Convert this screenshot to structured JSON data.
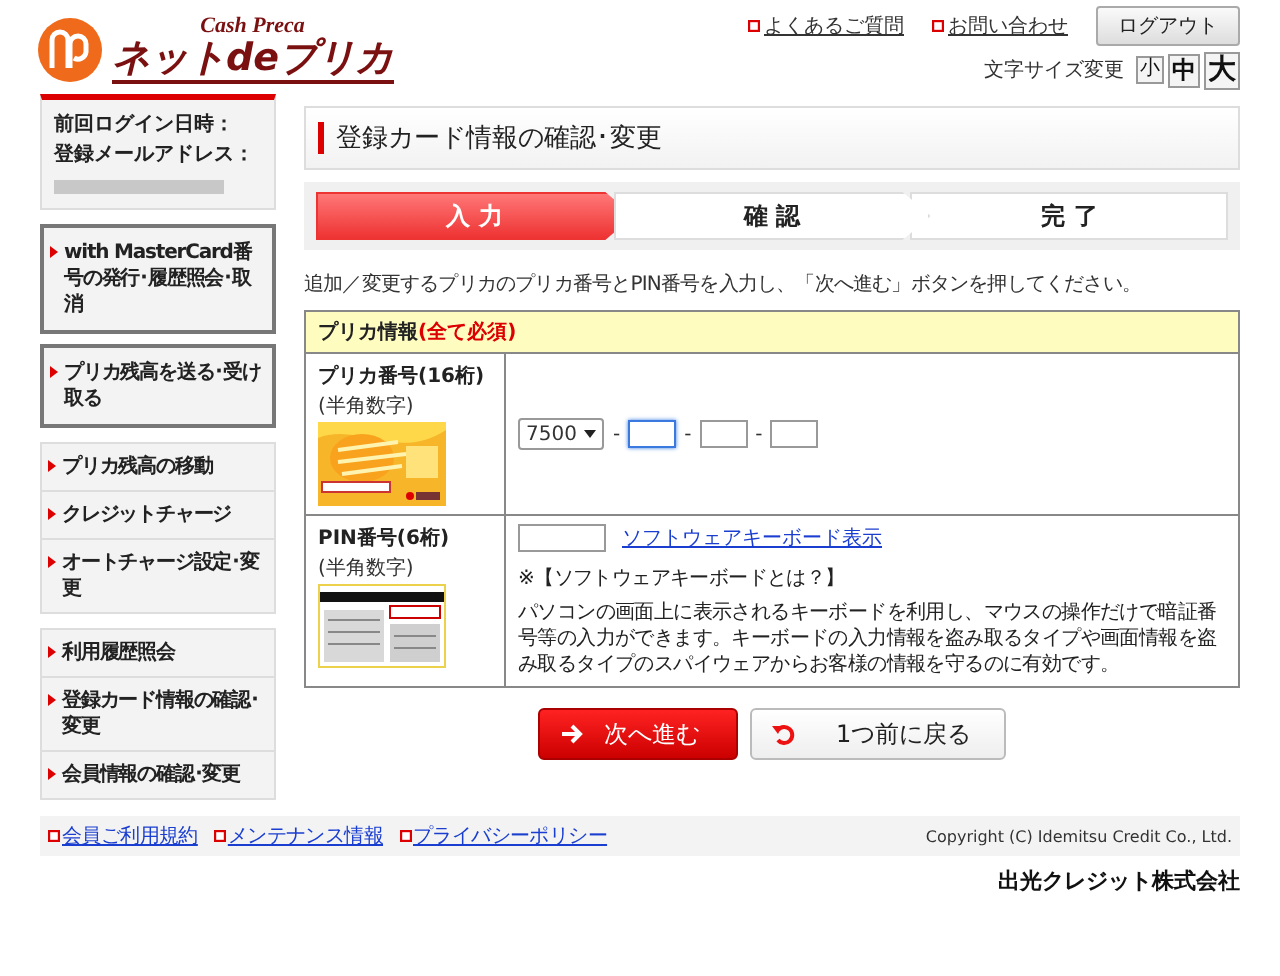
{
  "header": {
    "logo_tagline": "Cash Preca",
    "logo_name": "ネットdeプリカ",
    "links": [
      "よくあるご質問",
      "お問い合わせ"
    ],
    "logout": "ログアウト",
    "font_size_label": "文字サイズ変更",
    "font_sizes": [
      "小",
      "中",
      "大"
    ]
  },
  "account": {
    "last_login_label": "前回ログイン日時：",
    "email_label": "登録メールアドレス："
  },
  "sidebar": {
    "groups": [
      {
        "kind": "boxed",
        "items": [
          "with MasterCard番号の発行･履歴照会･取消",
          "プリカ残高を送る･受け取る"
        ]
      },
      {
        "kind": "list",
        "items": [
          "プリカ残高の移動",
          "クレジットチャージ",
          "オートチャージ設定･変更"
        ]
      },
      {
        "kind": "list",
        "items": [
          "利用履歴照会",
          "登録カード情報の確認･変更",
          "会員情報の確認･変更"
        ]
      }
    ]
  },
  "main": {
    "title": "登録カード情報の確認･変更",
    "steps": [
      {
        "label": "入 力",
        "selected": true
      },
      {
        "label": "確 認",
        "selected": false
      },
      {
        "label": "完 了",
        "selected": false
      }
    ],
    "instruction": "追加／変更するプリカのプリカ番号とPIN番号を入力し、「次へ進む」ボタンを押してください。",
    "form": {
      "title": "プリカ情報",
      "required_note": "(全て必須)",
      "rows": [
        {
          "kind": "card_number",
          "label": "プリカ番号(16桁)",
          "sublabel": "(半角数字)",
          "prefix": "7500",
          "separator": "-",
          "segments": [
            {
              "focused": true
            },
            {
              "focused": false
            },
            {
              "focused": false
            }
          ]
        },
        {
          "kind": "pin",
          "label": "PIN番号(6桁)",
          "sublabel": "(半角数字)",
          "keyboard_link": "ソフトウェアキーボード表示",
          "note_title": "※【ソフトウェアキーボードとは？】",
          "note": "パソコンの画面上に表示されるキーボードを利用し、マウスの操作だけで暗証番号等の入力ができます。キーボードの入力情報を盗み取るタイプや画面情報を盗み取るタイプのスパイウェアからお客様の情報を守るのに有効です。"
        }
      ]
    },
    "buttons": [
      {
        "kind": "primary",
        "label": "次へ進む"
      },
      {
        "kind": "secondary",
        "label": "1つ前に戻る"
      }
    ]
  },
  "footer": {
    "links": [
      "会員ご利用規約",
      "メンテナンス情報",
      "プライバシーポリシー"
    ],
    "copyright": "Copyright (C) Idemitsu Credit Co., Ltd.",
    "company": "出光クレジット株式会社"
  }
}
